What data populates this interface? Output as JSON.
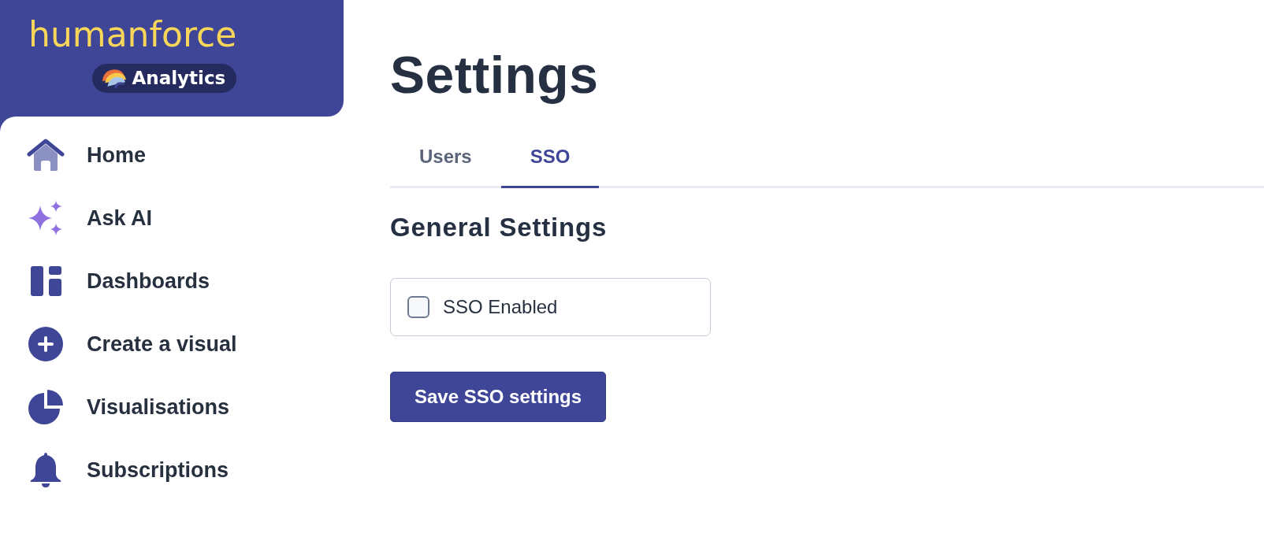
{
  "sidebar": {
    "logo": {
      "wordmark": "humanforce",
      "badge": "Analytics"
    },
    "items": [
      {
        "label": "Home",
        "kind": "home"
      },
      {
        "label": "Ask AI",
        "kind": "sparkles"
      },
      {
        "label": "Dashboards",
        "kind": "dashboards"
      },
      {
        "label": "Create a visual",
        "kind": "create"
      },
      {
        "label": "Visualisations",
        "kind": "pie"
      },
      {
        "label": "Subscriptions",
        "kind": "bell"
      }
    ]
  },
  "page": {
    "title": "Settings",
    "tabs": [
      {
        "label": "Users",
        "selected": false
      },
      {
        "label": "SSO",
        "selected": true
      }
    ],
    "section": {
      "heading": "General Settings",
      "options": [
        {
          "label": "SSO Enabled",
          "checked": false
        }
      ],
      "save_button": "Save SSO settings"
    }
  }
}
